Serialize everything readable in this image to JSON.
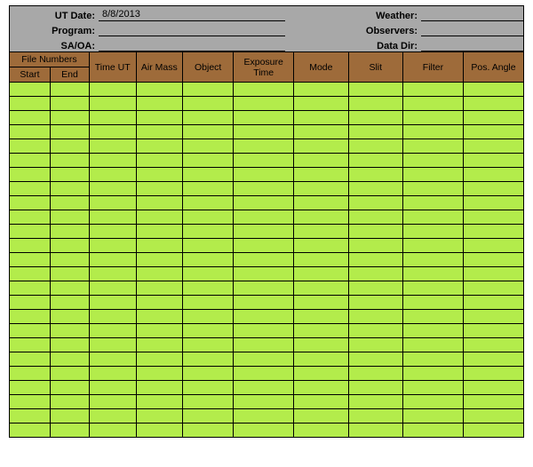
{
  "header": {
    "left_labels": {
      "ut_date": "UT Date:",
      "program": "Program:",
      "saoa": "SA/OA:"
    },
    "right_labels": {
      "weather": "Weather:",
      "observers": "Observers:",
      "data_dir": "Data Dir:"
    },
    "values": {
      "ut_date": "8/8/2013",
      "program": "",
      "saoa": "",
      "weather": "",
      "observers": "",
      "data_dir": ""
    }
  },
  "columns": {
    "file_numbers_group": "File Numbers",
    "start": "Start",
    "end": "End",
    "time_ut": "Time UT",
    "air_mass": "Air Mass",
    "object": "Object",
    "exposure_time": "Exposure Time",
    "mode": "Mode",
    "slit": "Slit",
    "filter": "Filter",
    "pos_angle": "Pos. Angle"
  },
  "rows": [
    {
      "start": "",
      "end": "",
      "time_ut": "",
      "air_mass": "",
      "object": "",
      "exposure_time": "",
      "mode": "",
      "slit": "",
      "filter": "",
      "pos_angle": ""
    },
    {
      "start": "",
      "end": "",
      "time_ut": "",
      "air_mass": "",
      "object": "",
      "exposure_time": "",
      "mode": "",
      "slit": "",
      "filter": "",
      "pos_angle": ""
    },
    {
      "start": "",
      "end": "",
      "time_ut": "",
      "air_mass": "",
      "object": "",
      "exposure_time": "",
      "mode": "",
      "slit": "",
      "filter": "",
      "pos_angle": ""
    },
    {
      "start": "",
      "end": "",
      "time_ut": "",
      "air_mass": "",
      "object": "",
      "exposure_time": "",
      "mode": "",
      "slit": "",
      "filter": "",
      "pos_angle": ""
    },
    {
      "start": "",
      "end": "",
      "time_ut": "",
      "air_mass": "",
      "object": "",
      "exposure_time": "",
      "mode": "",
      "slit": "",
      "filter": "",
      "pos_angle": ""
    },
    {
      "start": "",
      "end": "",
      "time_ut": "",
      "air_mass": "",
      "object": "",
      "exposure_time": "",
      "mode": "",
      "slit": "",
      "filter": "",
      "pos_angle": ""
    },
    {
      "start": "",
      "end": "",
      "time_ut": "",
      "air_mass": "",
      "object": "",
      "exposure_time": "",
      "mode": "",
      "slit": "",
      "filter": "",
      "pos_angle": ""
    },
    {
      "start": "",
      "end": "",
      "time_ut": "",
      "air_mass": "",
      "object": "",
      "exposure_time": "",
      "mode": "",
      "slit": "",
      "filter": "",
      "pos_angle": ""
    },
    {
      "start": "",
      "end": "",
      "time_ut": "",
      "air_mass": "",
      "object": "",
      "exposure_time": "",
      "mode": "",
      "slit": "",
      "filter": "",
      "pos_angle": ""
    },
    {
      "start": "",
      "end": "",
      "time_ut": "",
      "air_mass": "",
      "object": "",
      "exposure_time": "",
      "mode": "",
      "slit": "",
      "filter": "",
      "pos_angle": ""
    },
    {
      "start": "",
      "end": "",
      "time_ut": "",
      "air_mass": "",
      "object": "",
      "exposure_time": "",
      "mode": "",
      "slit": "",
      "filter": "",
      "pos_angle": ""
    },
    {
      "start": "",
      "end": "",
      "time_ut": "",
      "air_mass": "",
      "object": "",
      "exposure_time": "",
      "mode": "",
      "slit": "",
      "filter": "",
      "pos_angle": ""
    },
    {
      "start": "",
      "end": "",
      "time_ut": "",
      "air_mass": "",
      "object": "",
      "exposure_time": "",
      "mode": "",
      "slit": "",
      "filter": "",
      "pos_angle": ""
    },
    {
      "start": "",
      "end": "",
      "time_ut": "",
      "air_mass": "",
      "object": "",
      "exposure_time": "",
      "mode": "",
      "slit": "",
      "filter": "",
      "pos_angle": ""
    },
    {
      "start": "",
      "end": "",
      "time_ut": "",
      "air_mass": "",
      "object": "",
      "exposure_time": "",
      "mode": "",
      "slit": "",
      "filter": "",
      "pos_angle": ""
    },
    {
      "start": "",
      "end": "",
      "time_ut": "",
      "air_mass": "",
      "object": "",
      "exposure_time": "",
      "mode": "",
      "slit": "",
      "filter": "",
      "pos_angle": ""
    },
    {
      "start": "",
      "end": "",
      "time_ut": "",
      "air_mass": "",
      "object": "",
      "exposure_time": "",
      "mode": "",
      "slit": "",
      "filter": "",
      "pos_angle": ""
    },
    {
      "start": "",
      "end": "",
      "time_ut": "",
      "air_mass": "",
      "object": "",
      "exposure_time": "",
      "mode": "",
      "slit": "",
      "filter": "",
      "pos_angle": ""
    },
    {
      "start": "",
      "end": "",
      "time_ut": "",
      "air_mass": "",
      "object": "",
      "exposure_time": "",
      "mode": "",
      "slit": "",
      "filter": "",
      "pos_angle": ""
    },
    {
      "start": "",
      "end": "",
      "time_ut": "",
      "air_mass": "",
      "object": "",
      "exposure_time": "",
      "mode": "",
      "slit": "",
      "filter": "",
      "pos_angle": ""
    },
    {
      "start": "",
      "end": "",
      "time_ut": "",
      "air_mass": "",
      "object": "",
      "exposure_time": "",
      "mode": "",
      "slit": "",
      "filter": "",
      "pos_angle": ""
    },
    {
      "start": "",
      "end": "",
      "time_ut": "",
      "air_mass": "",
      "object": "",
      "exposure_time": "",
      "mode": "",
      "slit": "",
      "filter": "",
      "pos_angle": ""
    },
    {
      "start": "",
      "end": "",
      "time_ut": "",
      "air_mass": "",
      "object": "",
      "exposure_time": "",
      "mode": "",
      "slit": "",
      "filter": "",
      "pos_angle": ""
    },
    {
      "start": "",
      "end": "",
      "time_ut": "",
      "air_mass": "",
      "object": "",
      "exposure_time": "",
      "mode": "",
      "slit": "",
      "filter": "",
      "pos_angle": ""
    },
    {
      "start": "",
      "end": "",
      "time_ut": "",
      "air_mass": "",
      "object": "",
      "exposure_time": "",
      "mode": "",
      "slit": "",
      "filter": "",
      "pos_angle": ""
    }
  ]
}
